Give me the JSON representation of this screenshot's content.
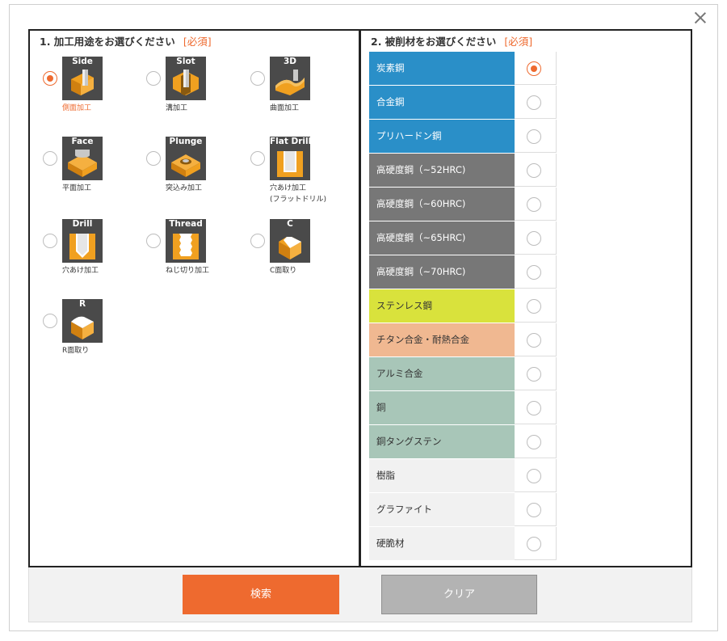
{
  "modal": {
    "close_label": "×"
  },
  "section1": {
    "title": "1. 加工用途をお選びください",
    "required": "[必須]",
    "options": [
      {
        "icon_title": "Side",
        "caption": "側面加工",
        "selected": true
      },
      {
        "icon_title": "Slot",
        "caption": "溝加工",
        "selected": false
      },
      {
        "icon_title": "3D",
        "caption": "曲面加工",
        "selected": false
      },
      {
        "icon_title": "Face",
        "caption": "平面加工",
        "selected": false
      },
      {
        "icon_title": "Plunge",
        "caption": "突込み加工",
        "selected": false
      },
      {
        "icon_title": "Flat Drill",
        "caption": "穴あけ加工",
        "caption2": "(フラットドリル)",
        "selected": false
      },
      {
        "icon_title": "Drill",
        "caption": "穴あけ加工",
        "selected": false
      },
      {
        "icon_title": "Thread",
        "caption": "ねじ切り加工",
        "selected": false
      },
      {
        "icon_title": "C",
        "caption": "C面取り",
        "selected": false
      },
      {
        "icon_title": "R",
        "caption": "R面取り",
        "selected": false
      }
    ]
  },
  "section2": {
    "title": "2. 被削材をお選びください",
    "required": "[必須]",
    "materials": [
      {
        "name": "炭素鋼",
        "bg": "#2a8fc8",
        "fg": "#ffffff",
        "selected": true
      },
      {
        "name": "合金鋼",
        "bg": "#2a8fc8",
        "fg": "#ffffff",
        "selected": false
      },
      {
        "name": "プリハードン鋼",
        "bg": "#2a8fc8",
        "fg": "#ffffff",
        "selected": false
      },
      {
        "name": "高硬度鋼（~52HRC)",
        "bg": "#777777",
        "fg": "#ffffff",
        "selected": false
      },
      {
        "name": "高硬度鋼（~60HRC)",
        "bg": "#777777",
        "fg": "#ffffff",
        "selected": false
      },
      {
        "name": "高硬度鋼（~65HRC)",
        "bg": "#777777",
        "fg": "#ffffff",
        "selected": false
      },
      {
        "name": "高硬度鋼（~70HRC)",
        "bg": "#777777",
        "fg": "#ffffff",
        "selected": false
      },
      {
        "name": "ステンレス鋼",
        "bg": "#d9e23c",
        "fg": "#333333",
        "selected": false
      },
      {
        "name": "チタン合金・耐熱合金",
        "bg": "#f0b891",
        "fg": "#333333",
        "selected": false
      },
      {
        "name": "アルミ合金",
        "bg": "#a8c6b8",
        "fg": "#333333",
        "selected": false
      },
      {
        "name": "銅",
        "bg": "#a8c6b8",
        "fg": "#333333",
        "selected": false
      },
      {
        "name": "銅タングステン",
        "bg": "#a8c6b8",
        "fg": "#333333",
        "selected": false
      },
      {
        "name": "樹脂",
        "bg": "#f1f1f1",
        "fg": "#333333",
        "selected": false
      },
      {
        "name": "グラファイト",
        "bg": "#f1f1f1",
        "fg": "#333333",
        "selected": false
      },
      {
        "name": "硬脆材",
        "bg": "#f1f1f1",
        "fg": "#333333",
        "selected": false
      }
    ]
  },
  "buttons": {
    "search": "検索",
    "clear": "クリア"
  },
  "colors": {
    "accent": "#ee6a2f",
    "icon_bg": "#4a4a4a",
    "workpiece": "#f0a020"
  },
  "icons": [
    "side-cut-icon",
    "slot-cut-icon",
    "3d-cut-icon",
    "face-cut-icon",
    "plunge-cut-icon",
    "flat-drill-icon",
    "drill-icon",
    "thread-icon",
    "c-chamfer-icon",
    "r-chamfer-icon"
  ]
}
